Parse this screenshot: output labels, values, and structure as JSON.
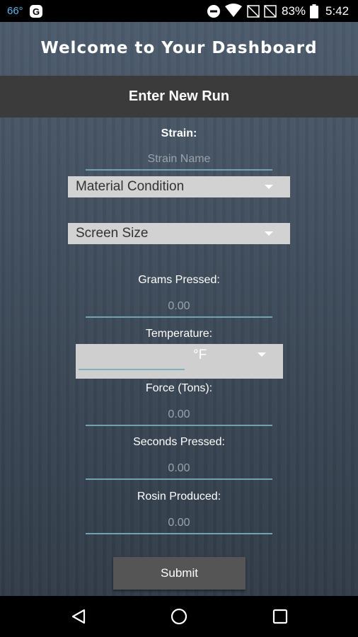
{
  "status_bar": {
    "temperature": "66°",
    "notification_badge": "G",
    "battery_percent": "83%",
    "time": "5:42"
  },
  "welcome_title": "Welcome to Your Dashboard",
  "header": {
    "title": "Enter New Run"
  },
  "form": {
    "strain_label": "Strain:",
    "strain_placeholder": "Strain Name",
    "material_condition": "Material Condition",
    "screen_size": "Screen Size",
    "grams_pressed_label": "Grams Pressed:",
    "grams_pressed_value": "0.00",
    "temperature_label": "Temperature:",
    "temperature_unit": "°F",
    "force_label": "Force (Tons):",
    "force_value": "0.00",
    "seconds_label": "Seconds Pressed:",
    "seconds_value": "0.00",
    "rosin_label": "Rosin Produced:",
    "rosin_value": "0.00",
    "submit_label": "Submit"
  },
  "icons": [
    "weather-icon",
    "notification-badge-icon",
    "do-not-disturb-icon",
    "wifi-icon",
    "no-signal-icon",
    "battery-icon",
    "back-icon",
    "home-icon",
    "recents-icon"
  ],
  "colors": {
    "accent_underline": "#6fa3b3",
    "header_bar": "#3b3b3b",
    "spinner_bg": "#d2d2d2",
    "submit_bg": "#555555"
  }
}
